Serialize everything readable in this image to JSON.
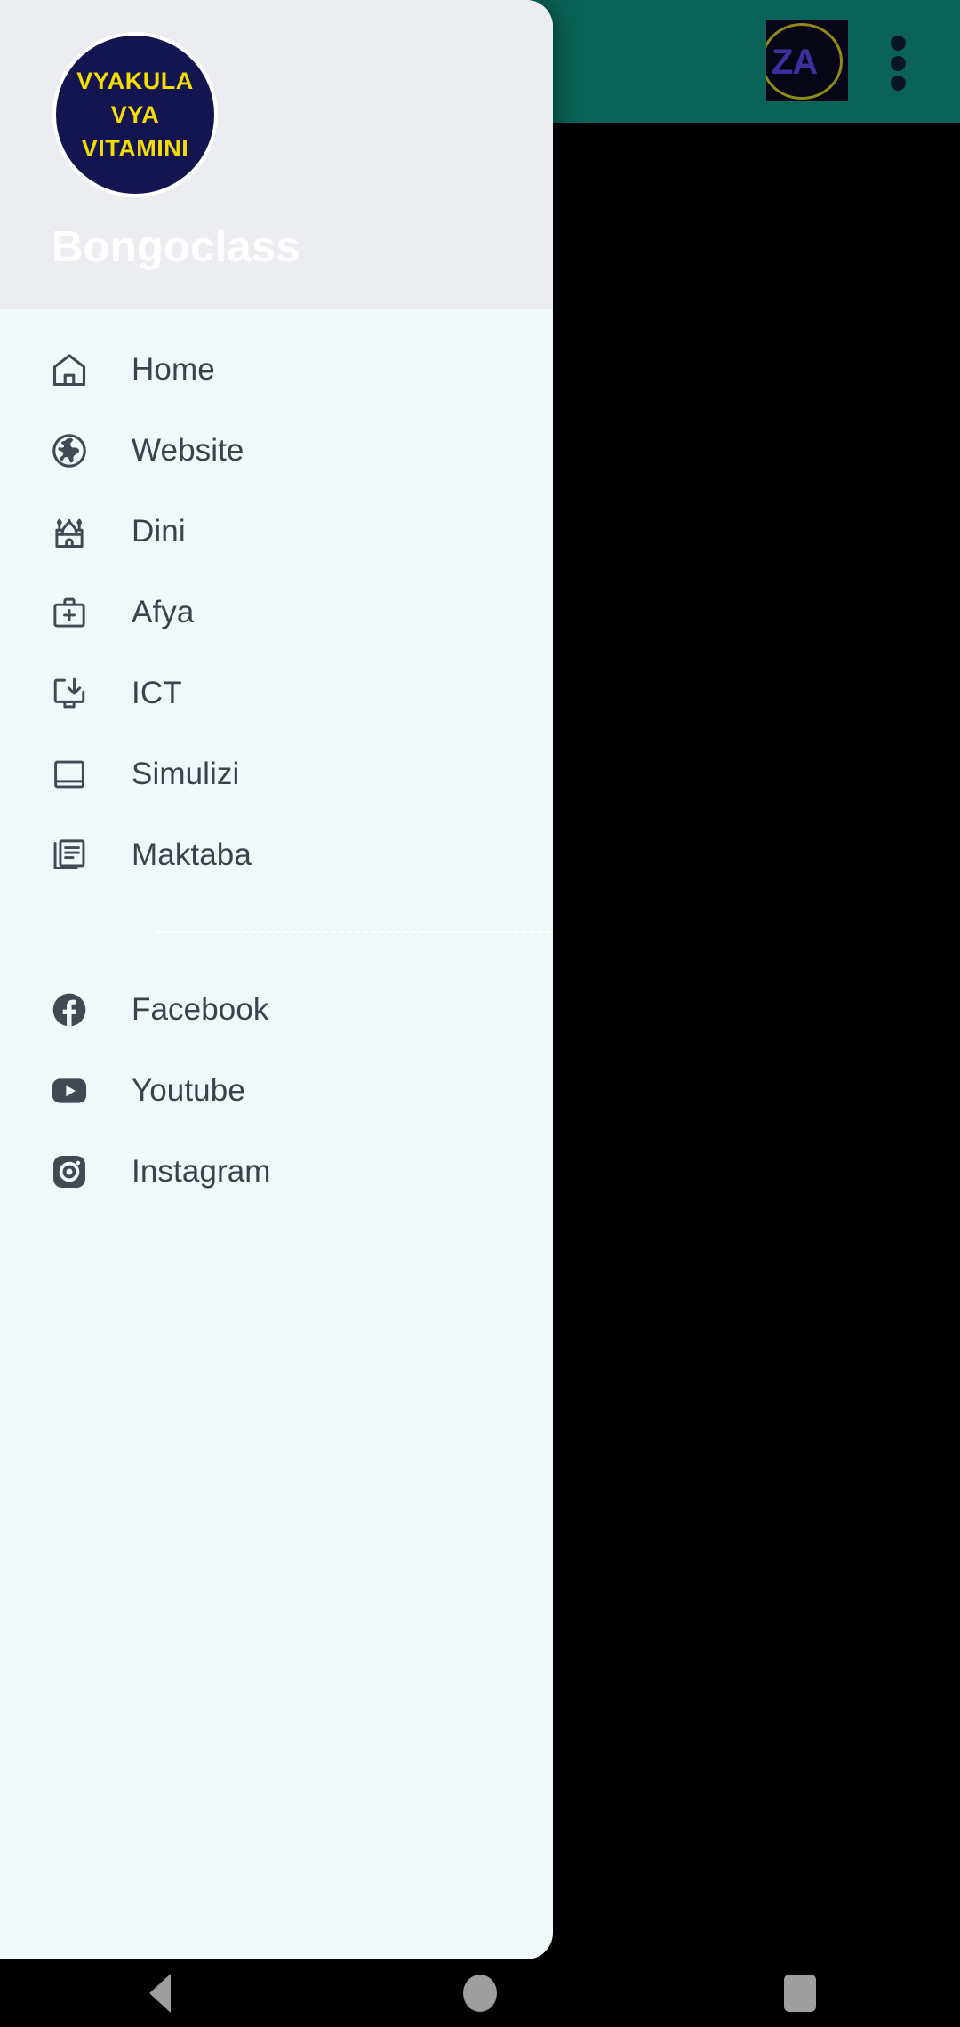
{
  "app_bar": {
    "background_color": "#0A6358",
    "logo_text": "ZA",
    "overflow_menu_label": "More options"
  },
  "drawer": {
    "header": {
      "background_color": "#EBEDF0",
      "title": "Bongoclass",
      "logo": {
        "background_color": "#141450",
        "text_color": "#F4DD00",
        "lines": [
          "VYAKULA",
          "VYA",
          "VITAMINI"
        ]
      }
    },
    "list_background_color": "#F0F8FA",
    "items": [
      {
        "label": "Home",
        "icon": "home-icon"
      },
      {
        "label": "Website",
        "icon": "globe-icon"
      },
      {
        "label": "Dini",
        "icon": "mosque-icon"
      },
      {
        "label": "Afya",
        "icon": "medical-briefcase-icon"
      },
      {
        "label": "ICT",
        "icon": "monitor-download-icon"
      },
      {
        "label": "Simulizi",
        "icon": "book-icon"
      },
      {
        "label": "Maktaba",
        "icon": "library-articles-icon"
      }
    ],
    "social_items": [
      {
        "label": "Facebook",
        "icon": "facebook-icon"
      },
      {
        "label": "Youtube",
        "icon": "youtube-icon"
      },
      {
        "label": "Instagram",
        "icon": "instagram-icon"
      }
    ]
  },
  "system_nav": {
    "back_label": "Back",
    "home_label": "Home",
    "recents_label": "Recents",
    "icon_color": "#9E9E9E"
  }
}
